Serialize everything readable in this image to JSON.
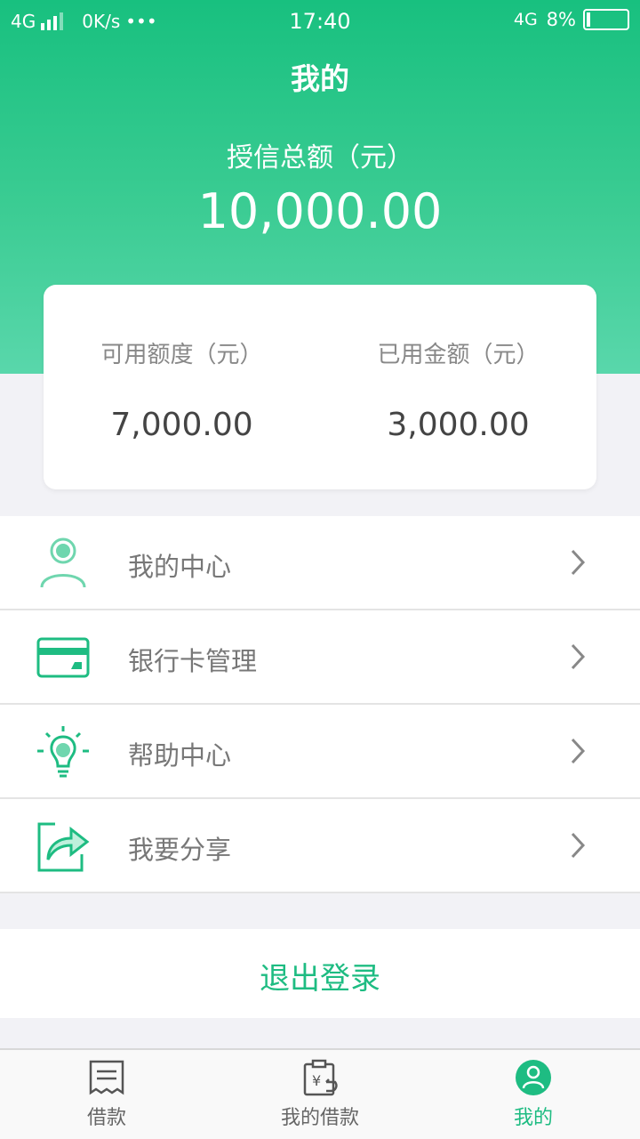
{
  "status_bar": {
    "network_left": "4G",
    "speed": "0K/s",
    "dots": "•••",
    "time": "17:40",
    "network_right": "4G",
    "battery": "8%"
  },
  "header": {
    "title": "我的",
    "credit_label": "授信总额（元）",
    "credit_value": "10,000.00"
  },
  "card": {
    "available_label": "可用额度（元）",
    "available_value": "7,000.00",
    "used_label": "已用金额（元）",
    "used_value": "3,000.00"
  },
  "menu": {
    "items": [
      {
        "label": "我的中心",
        "icon": "user-icon"
      },
      {
        "label": "银行卡管理",
        "icon": "bank-card-icon"
      },
      {
        "label": "帮助中心",
        "icon": "lightbulb-icon"
      },
      {
        "label": "我要分享",
        "icon": "share-icon"
      }
    ]
  },
  "logout": {
    "label": "退出登录"
  },
  "tabbar": {
    "tabs": [
      {
        "label": "借款",
        "icon": "receipt-icon"
      },
      {
        "label": "我的借款",
        "icon": "loan-clipboard-icon"
      },
      {
        "label": "我的",
        "icon": "profile-icon"
      }
    ],
    "active_index": 2
  },
  "colors": {
    "accent": "#1ebc82",
    "header_top": "#18c07f",
    "header_bottom": "#59d7ab"
  }
}
